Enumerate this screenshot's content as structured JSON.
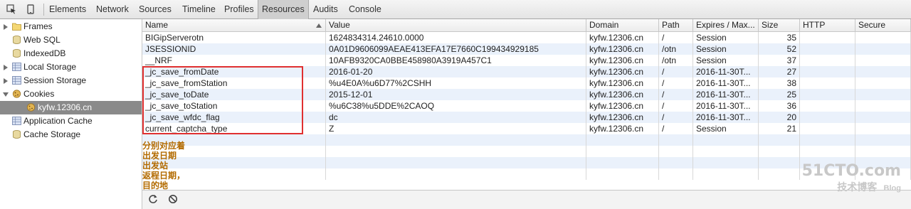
{
  "toolbar": {
    "tabs": [
      "Elements",
      "Network",
      "Sources",
      "Timeline",
      "Profiles",
      "Resources",
      "Audits",
      "Console"
    ],
    "active": "Resources"
  },
  "sidebar": {
    "items": [
      {
        "label": "Frames",
        "icon": "folder-icon",
        "arrow": "right"
      },
      {
        "label": "Web SQL",
        "icon": "database-icon",
        "arrow": ""
      },
      {
        "label": "IndexedDB",
        "icon": "database-icon",
        "arrow": ""
      },
      {
        "label": "Local Storage",
        "icon": "grid-storage-icon",
        "arrow": "right"
      },
      {
        "label": "Session Storage",
        "icon": "grid-storage-icon",
        "arrow": "right"
      },
      {
        "label": "Cookies",
        "icon": "cookie-icon",
        "arrow": "down"
      },
      {
        "label": "kyfw.12306.cn",
        "icon": "cookie-icon",
        "arrow": "",
        "selected": true
      },
      {
        "label": "Application Cache",
        "icon": "grid-storage-icon",
        "arrow": ""
      },
      {
        "label": "Cache Storage",
        "icon": "database-icon",
        "arrow": ""
      }
    ]
  },
  "table": {
    "headers": [
      "Name",
      "Value",
      "Domain",
      "Path",
      "Expires / Max...",
      "Size",
      "HTTP",
      "Secure"
    ],
    "rows": [
      [
        "BIGipServerotn",
        "1624834314.24610.0000",
        "kyfw.12306.cn",
        "/",
        "Session",
        "35",
        "",
        ""
      ],
      [
        "JSESSIONID",
        "0A01D9606099AEAE413EFA17E7660C199434929185",
        "kyfw.12306.cn",
        "/otn",
        "Session",
        "52",
        "",
        ""
      ],
      [
        "__NRF",
        "10AFB9320CA0BBE458980A3919A457C1",
        "kyfw.12306.cn",
        "/otn",
        "Session",
        "37",
        "",
        ""
      ],
      [
        "_jc_save_fromDate",
        "2016-01-20",
        "kyfw.12306.cn",
        "/",
        "2016-11-30T...",
        "27",
        "",
        ""
      ],
      [
        "_jc_save_fromStation",
        "%u4E0A%u6D77%2CSHH",
        "kyfw.12306.cn",
        "/",
        "2016-11-30T...",
        "38",
        "",
        ""
      ],
      [
        "_jc_save_toDate",
        "2015-12-01",
        "kyfw.12306.cn",
        "/",
        "2016-11-30T...",
        "25",
        "",
        ""
      ],
      [
        "_jc_save_toStation",
        "%u6C38%u5DDE%2CAOQ",
        "kyfw.12306.cn",
        "/",
        "2016-11-30T...",
        "36",
        "",
        ""
      ],
      [
        "_jc_save_wfdc_flag",
        "dc",
        "kyfw.12306.cn",
        "/",
        "2016-11-30T...",
        "20",
        "",
        ""
      ],
      [
        "current_captcha_type",
        "Z",
        "kyfw.12306.cn",
        "/",
        "Session",
        "21",
        "",
        ""
      ]
    ]
  },
  "annotation": [
    "分别对应着",
    "出发日期",
    "出发站",
    "返程日期，",
    "目的地"
  ],
  "watermark": {
    "logo": "51CTO.com",
    "sub1": "技术博客",
    "sub2": "Blog"
  },
  "colors": {
    "highlight_box": "#e03030",
    "annotation": "#b36b00",
    "selected": "#8a8a8a",
    "alt_row": "#eaf1fb"
  }
}
